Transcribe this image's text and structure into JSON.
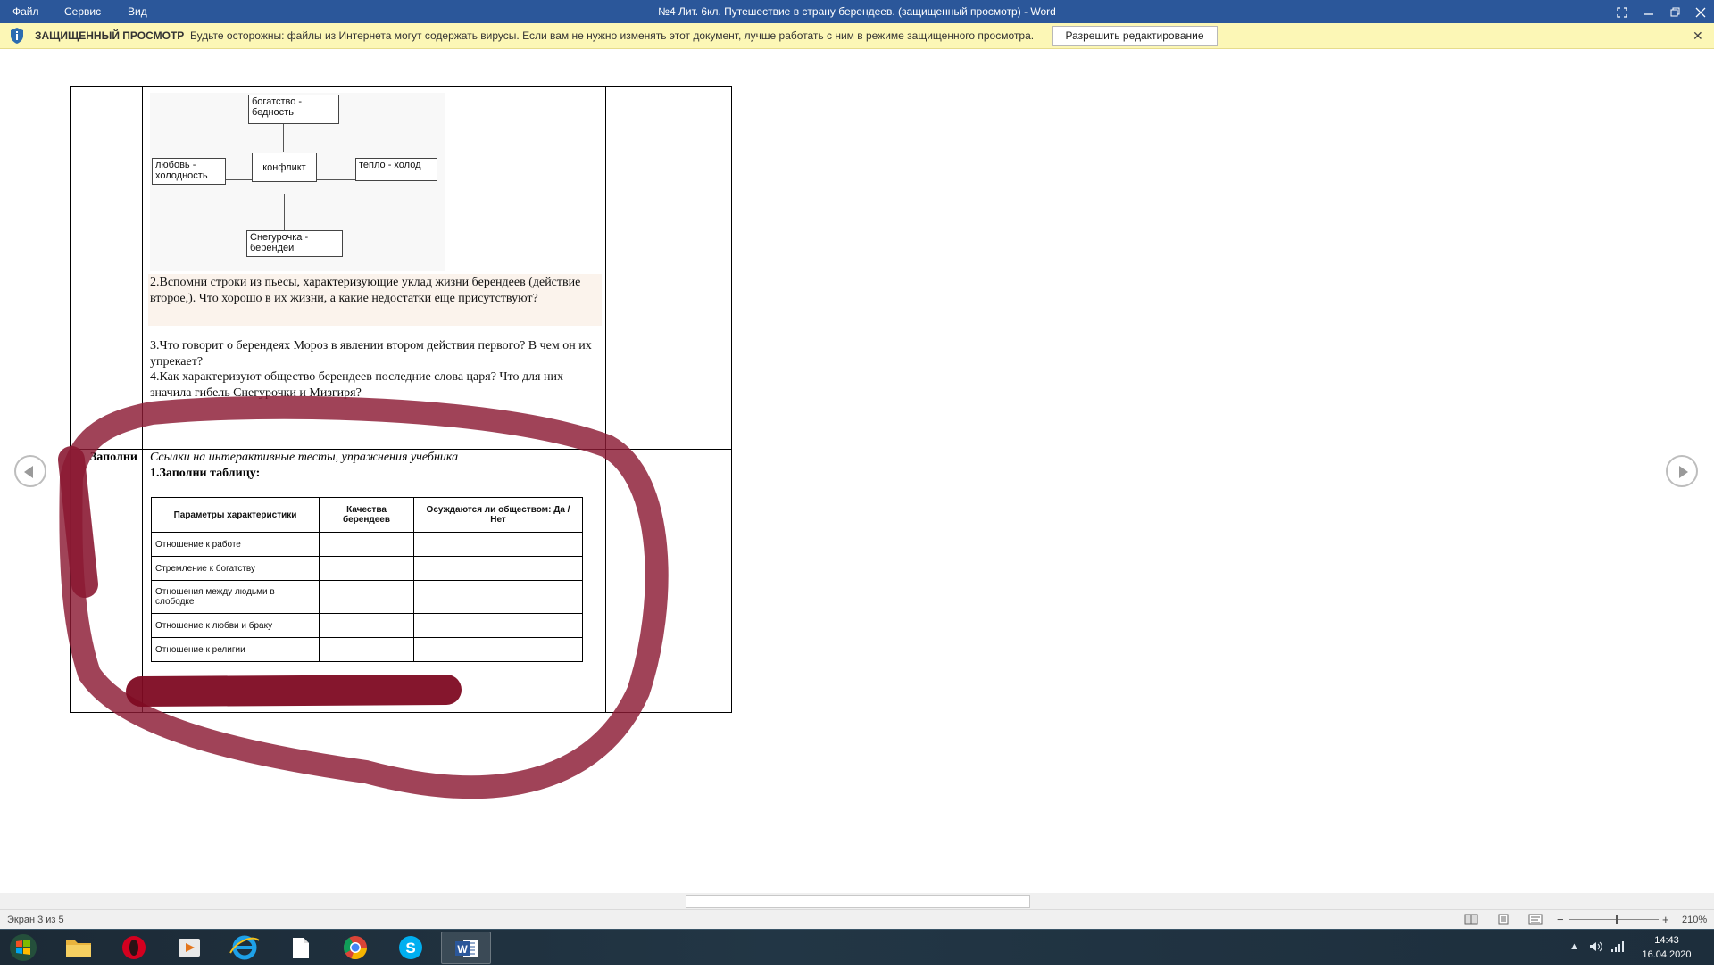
{
  "titlebar": {
    "menu": [
      "Файл",
      "Сервис",
      "Вид"
    ],
    "title": "№4  Лит. 6кл. Путешествие в страну берендеев. (защищенный просмотр) - Word"
  },
  "protected_view": {
    "label": "ЗАЩИЩЕННЫЙ ПРОСМОТР",
    "message": "Будьте осторожны: файлы из Интернета могут содержать вирусы. Если вам не нужно изменять этот документ, лучше работать с ним в режиме защищенного просмотра.",
    "button": "Разрешить редактирование"
  },
  "diagram": {
    "top": "богатство - бедность",
    "left": "любовь - холодность",
    "center": "конфликт",
    "right": "тепло - холод",
    "bottom": "Снегурочка - берендеи"
  },
  "questions": {
    "q2": "2.Вспомни строки из пьесы, характеризующие уклад жизни берендеев (действие второе,). Что хорошо в их жизни, а какие недостатки еще присутствуют?",
    "q3": "3.Что говорит о берендеях Мороз в явлении втором действия первого? В чем он их упрекает?",
    "q4": "4.Как характеризуют общество берендеев последние слова царя? Что для них значила гибель Снегурочки и Мизгиря?"
  },
  "row2": {
    "left_label": "Заполни",
    "links_text": "Ссылки на интерактивные тесты, упражнения учебника",
    "task_title": "1.Заполни таблицу:"
  },
  "table": {
    "headers": [
      "Параметры характеристики",
      "Качества берендеев",
      "Осуждаются ли обществом: Да / Нет"
    ],
    "rows": [
      "Отношение к работе",
      "Стремление к богатству",
      "Отношения между людьми в слободке",
      "Отношение к любви и браку",
      "Отношение к религии"
    ]
  },
  "statusbar": {
    "page_info": "Экран 3 из 5",
    "zoom": "210%"
  },
  "taskbar": {
    "time": "14:43",
    "date": "16.04.2020"
  },
  "colors": {
    "word_blue": "#2b579a",
    "protected_bar": "#fcf7b6",
    "annotation": "#8b1a33"
  }
}
